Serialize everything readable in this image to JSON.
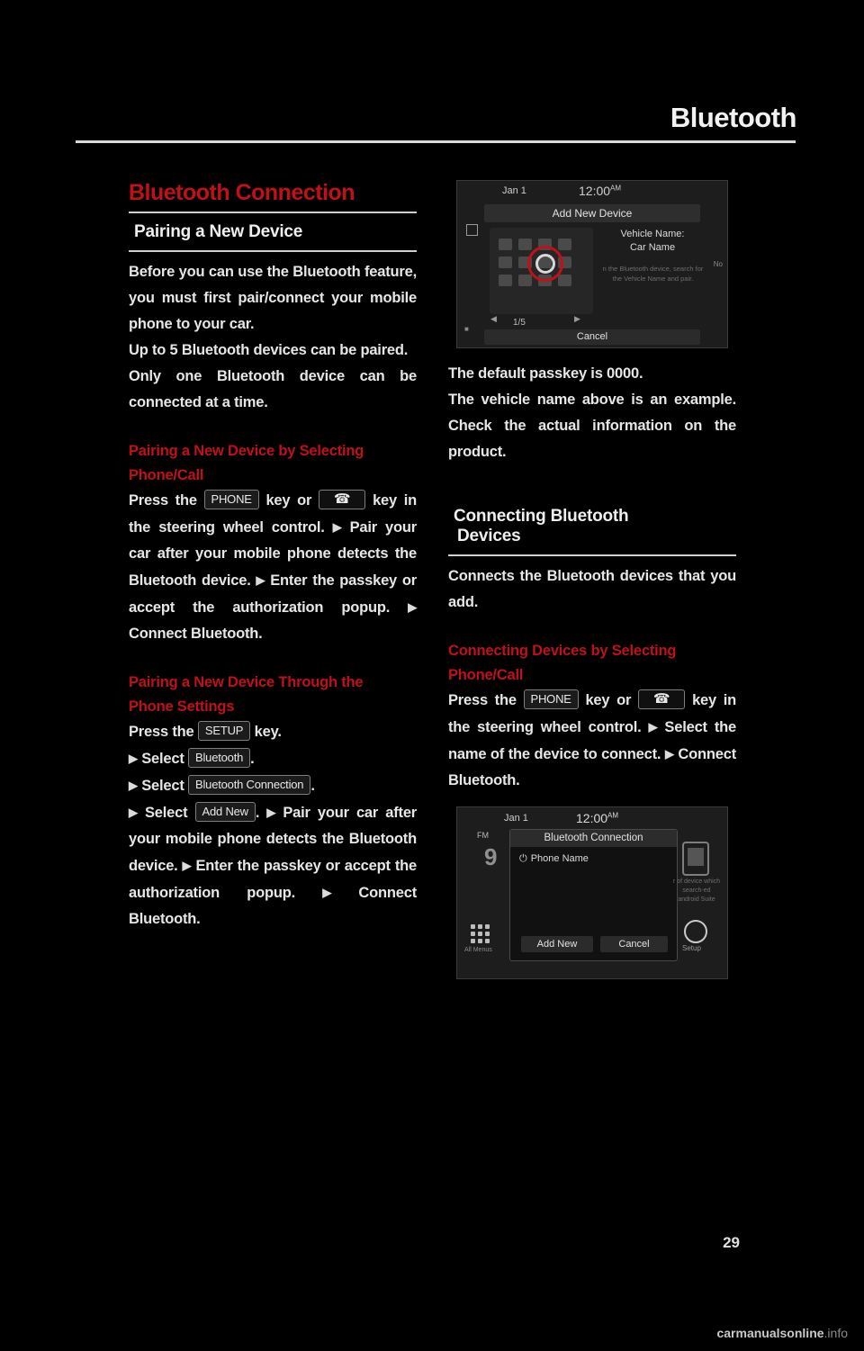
{
  "header": {
    "title": "Bluetooth"
  },
  "left": {
    "section_title": "Bluetooth Connection",
    "sub1": "Pairing a New Device",
    "p1": "Before you can use the Bluetooth feature, you must first pair/connect your mobile phone to your car.",
    "p2": "Up to 5 Bluetooth devices can be paired.",
    "p3": "Only one Bluetooth device can be connected at a time.",
    "h_red1_line1": "Pairing a New Device by Selecting",
    "h_red1_line2": "Phone/Call",
    "para_phone": {
      "t1": "Press the",
      "key1": "PHONE",
      "t2": "key or",
      "key2": "call-icon",
      "t3": "key in the steering wheel control.",
      "t4": "Pair your car after your mobile phone detects the Bluetooth device.",
      "t5": "Enter the passkey or accept the authorization popup.",
      "t6": "Connect Bluetooth."
    },
    "h_red2_line1": "Pairing a New Device Through the",
    "h_red2_line2": "Phone Settings",
    "para_setup": {
      "t1": "Press the",
      "key_setup": "SETUP",
      "t2": "key.",
      "t3": "Select",
      "key_bt": "Bluetooth",
      "t4": ".",
      "t5": "Select",
      "key_btc": "Bluetooth Connection",
      "t6": ".",
      "t7": "Select",
      "key_add": "Add New",
      "t8": ".",
      "t9": "Pair your car after your mobile phone detects the Bluetooth device.",
      "t10": "Enter the passkey or accept the authorization popup.",
      "t11": "Connect Bluetooth."
    }
  },
  "right": {
    "shot1": {
      "date": "Jan   1",
      "time": "12:00",
      "time_suffix": "AM",
      "title": "Add New Device",
      "vehicle_label_line1": "Vehicle Name:",
      "vehicle_label_line2": "Car Name",
      "small_text": "n the Bluetooth device, search for the Vehicle Name and pair.",
      "page_indicator": "1/5",
      "cancel": "Cancel",
      "side_label": "No"
    },
    "p_after_shot1_a": "The default passkey is 0000.",
    "p_after_shot1_b": "The vehicle name above is an example. Check the actual information on the product.",
    "sub2_line1": "Connecting Bluetooth",
    "sub2_line2": "Devices",
    "p_connect": "Connects the Bluetooth devices that you add.",
    "h_red3_line1": "Connecting Devices by Selecting",
    "h_red3_line2": "Phone/Call",
    "para_connect": {
      "t1": "Press the",
      "key1": "PHONE",
      "t2": "key or",
      "key2": "call-icon",
      "t3": "key in the steering wheel control.",
      "t4": "Select the name of the device to connect.",
      "t5": "Connect Bluetooth."
    },
    "shot2": {
      "date": "Jan   1",
      "time": "12:00",
      "time_suffix": "AM",
      "fm": "FM",
      "big_number": "9",
      "title": "Bluetooth Connection",
      "item": "Phone Name",
      "btn_add": "Add New",
      "btn_cancel": "Cancel",
      "right_text": "r of device which search-ed android Suite",
      "apps_label": "All Menus",
      "setup_label": "Setup"
    }
  },
  "footer": {
    "page_number": "29",
    "watermark_a": "carmanualsonline",
    "watermark_b": ".info"
  }
}
